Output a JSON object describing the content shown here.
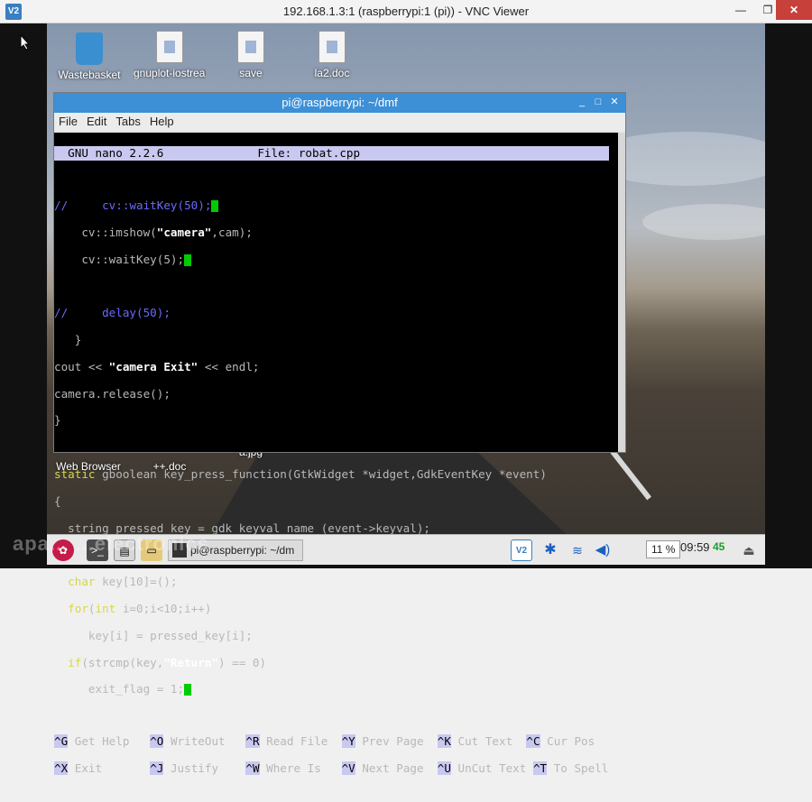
{
  "vnc_window": {
    "logo": "V2",
    "title": "192.168.1.3:1 (raspberrypi:1 (pi)) - VNC Viewer",
    "min": "—",
    "max": "❐",
    "close": "✕"
  },
  "desktop_icons": [
    {
      "label": "Wastebasket",
      "icon": "wastebasket-icon"
    },
    {
      "label": "gnuplot-iostream.h",
      "icon": "document-icon"
    },
    {
      "label": "save image.doc",
      "icon": "document-icon"
    },
    {
      "label": "la2.doc",
      "icon": "document-icon"
    }
  ],
  "desktop_icons_bottom": [
    {
      "label": "Web Browser"
    },
    {
      "label": "++.doc"
    },
    {
      "label": "a.jpg"
    }
  ],
  "terminal": {
    "title": "pi@raspberrypi: ~/dmf",
    "menu": [
      "File",
      "Edit",
      "Tabs",
      "Help"
    ],
    "nano_version": "  GNU nano 2.2.6",
    "nano_file": "File: robat.cpp",
    "help": [
      [
        {
          "k": "^G",
          "t": "Get Help"
        },
        {
          "k": "^O",
          "t": "WriteOut"
        },
        {
          "k": "^R",
          "t": "Read File"
        },
        {
          "k": "^Y",
          "t": "Prev Page"
        },
        {
          "k": "^K",
          "t": "Cut Text"
        },
        {
          "k": "^C",
          "t": "Cur Pos"
        }
      ],
      [
        {
          "k": "^X",
          "t": "Exit"
        },
        {
          "k": "^J",
          "t": "Justify"
        },
        {
          "k": "^W",
          "t": "Where Is"
        },
        {
          "k": "^V",
          "t": "Next Page"
        },
        {
          "k": "^U",
          "t": "UnCut Text"
        },
        {
          "k": "^T",
          "t": "To Spell"
        }
      ]
    ]
  },
  "code": {
    "l1a": "//",
    "l1b": "     cv::waitKey(50);",
    "l2a": "    cv::imshow(",
    "l2b": "\"camera\"",
    "l2c": ",cam);",
    "l3": "    cv::waitKey(5);",
    "l5a": "//",
    "l5b": "     delay(50);",
    "l6": "   }",
    "l7a": "cout << ",
    "l7b": "\"camera Exit\"",
    "l7c": " << endl;",
    "l8": "camera.release();",
    "l9": "}",
    "l11a": "static",
    "l11b": " gboolean key_press_function(GtkWidget *widget,GdkEventKey *event)",
    "l12": "{",
    "l13": "  string pressed_key = gdk_keyval_name (event->keyval);",
    "l15a": "  char",
    "l15b": " key[10]=();",
    "l16a": "  for",
    "l16b": "(",
    "l16c": "int",
    "l16d": " i=0;i<10;i++)",
    "l17": "     key[i] = pressed_key[i];",
    "l18a": "  if",
    "l18b": "(strcmp(key,",
    "l18c": "\"Return\"",
    "l18d": ") == 0)",
    "l19": "     exit_flag = 1;"
  },
  "taskbar": {
    "task_label": "pi@raspberrypi: ~/dm",
    "volume": "11 %",
    "clock": "09:59",
    "battery": "45"
  },
  "watermark": "apa... ...electronics"
}
